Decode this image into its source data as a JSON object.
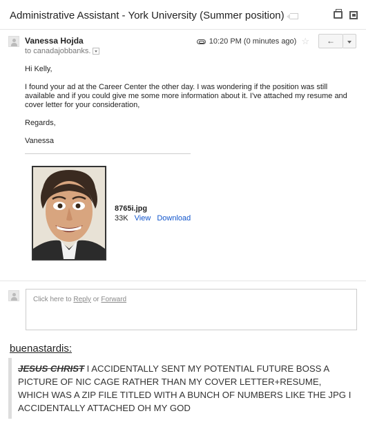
{
  "email": {
    "subject": "Administrative Assistant - York University (Summer position)",
    "sender_name": "Vanessa Hojda",
    "recipient": "to canadajobbanks.",
    "time": "10:20 PM (0 minutes ago)",
    "reply_glyph": "←",
    "body": {
      "greeting": "Hi Kelly,",
      "paragraph": "I found your ad at the Career Center the other day. I was wondering if the position was still available and if you could give me some more information about it. I've attached my resume and cover letter for your consideration,",
      "closing": "Regards,",
      "signature": "Vanessa"
    },
    "attachment": {
      "filename": "8765i.jpg",
      "size": "33K",
      "view_label": "View",
      "download_label": "Download"
    },
    "reply_box": {
      "prefix": "Click here to",
      "reply_label": "Reply",
      "or": "or",
      "forward_label": "Forward"
    }
  },
  "post": {
    "username": "buenastardis:",
    "quote_strike": "JESUS CHRIST",
    "quote_text": " I ACCIDENTALLY SENT MY POTENTIAL FUTURE BOSS A PICTURE OF NIC CAGE RATHER THAN MY COVER LETTER+RESUME, WHICH WAS A ZIP FILE TITLED WITH A BUNCH OF NUMBERS LIKE THE JPG I ACCIDENTALLY ATTACHED OH MY GOD"
  },
  "icons": {
    "label": "label-tag-icon",
    "print": "printer-icon",
    "new_window": "new-window-icon",
    "attachment": "paperclip-icon",
    "star": "star-icon",
    "reply": "reply-arrow-icon",
    "more": "chevron-down-icon"
  },
  "colors": {
    "link": "#1155cc",
    "quote_border": "#dddddd"
  }
}
